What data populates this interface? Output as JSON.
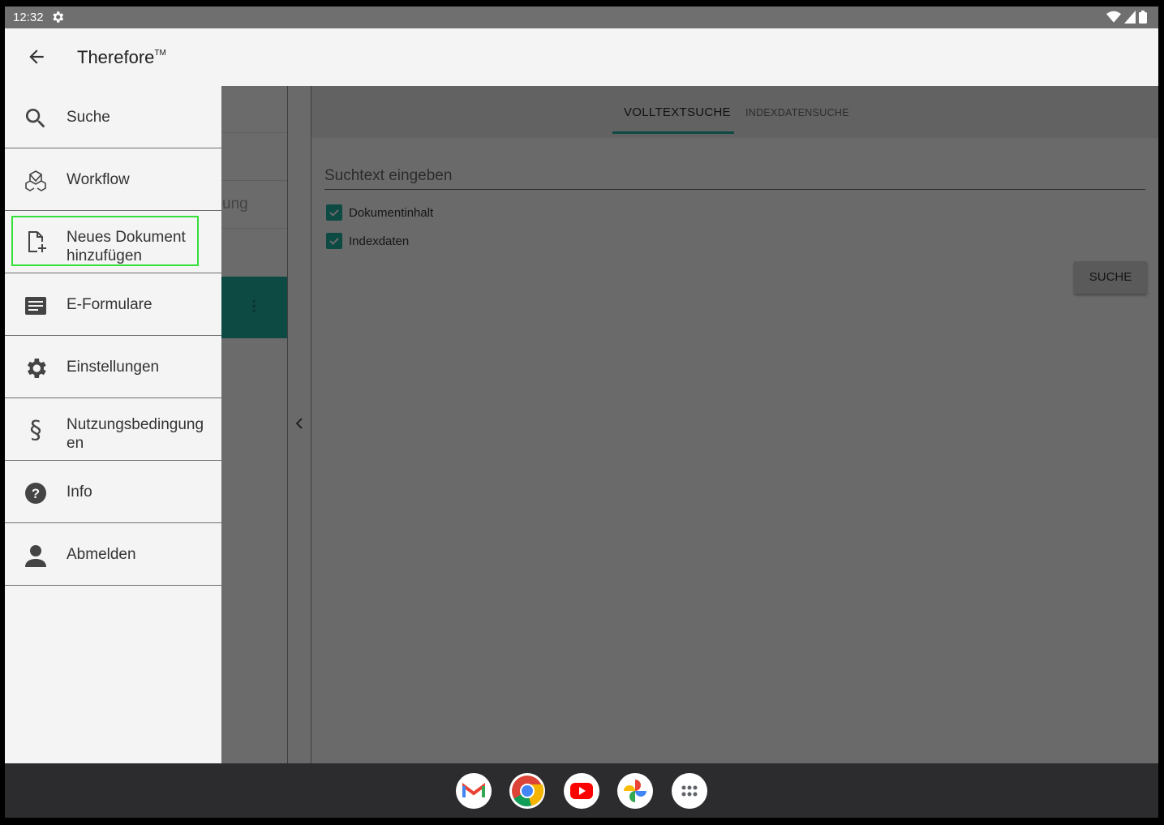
{
  "status_bar": {
    "time": "12:32",
    "icons": [
      "gear-icon",
      "wifi-icon",
      "signal-icon",
      "battery-icon"
    ]
  },
  "app_bar": {
    "title": "Therefore",
    "trademark": "TM"
  },
  "drawer": {
    "items": [
      {
        "label": "Suche",
        "icon": "search-icon"
      },
      {
        "label": "Workflow",
        "icon": "workflow-icon"
      },
      {
        "label": "Neues Dokument hinzufügen",
        "line1": "Neues Dokument",
        "line2": "hinzufügen",
        "icon": "add-document-icon"
      },
      {
        "label": "E-Formulare",
        "icon": "form-icon"
      },
      {
        "label": "Einstellungen",
        "icon": "settings-icon"
      },
      {
        "label": "Nutzungsbedingungen",
        "line1": "Nutzungsbedingung",
        "line2": "en",
        "icon": "paragraph-icon"
      },
      {
        "label": "Info",
        "icon": "help-icon"
      },
      {
        "label": "Abmelden",
        "icon": "person-icon"
      }
    ]
  },
  "background_list": {
    "partial_text": "ung"
  },
  "search": {
    "tabs": [
      {
        "label": "VOLLTEXTSUCHE",
        "active": true
      },
      {
        "label": "INDEXDATENSUCHE",
        "active": false
      }
    ],
    "placeholder": "Suchtext eingeben",
    "checkboxes": [
      {
        "label": "Dokumentinhalt",
        "checked": true
      },
      {
        "label": "Indexdaten",
        "checked": true
      }
    ],
    "button_label": "SUCHE"
  },
  "taskbar": {
    "apps": [
      "gmail-icon",
      "chrome-icon",
      "youtube-icon",
      "photos-icon",
      "app-drawer-icon"
    ]
  },
  "colors": {
    "accent": "#0d4a43",
    "highlight": "#35e03a",
    "drawer_bg": "#f4f4f4",
    "scrim": "#6b6b6b"
  }
}
